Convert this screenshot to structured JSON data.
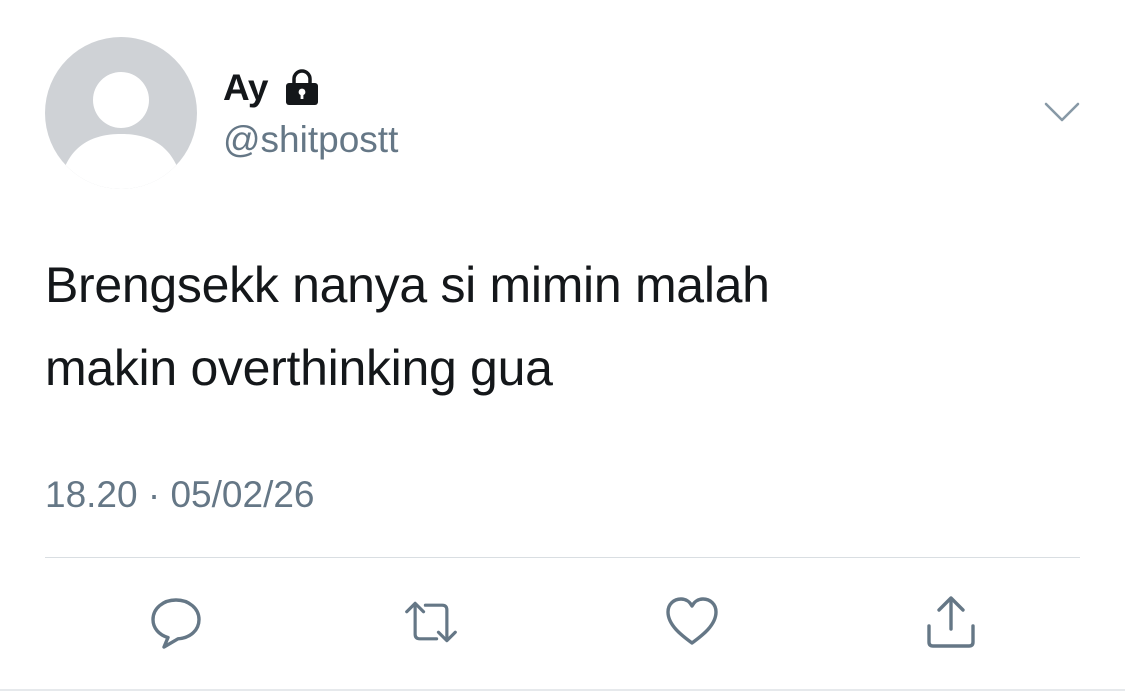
{
  "author": {
    "display_name": "Ay",
    "handle": "@shitpostt",
    "avatar_icon": "default-avatar-icon",
    "protected_icon": "lock-icon"
  },
  "tweet": {
    "text_lines": [
      "Brengsekk nanya si mimin malah",
      "makin overthinking gua"
    ],
    "time": "18.20",
    "separator": "·",
    "date": "05/02/26"
  },
  "actions": [
    {
      "name": "reply",
      "icon": "comment-icon"
    },
    {
      "name": "retweet",
      "icon": "retweet-icon"
    },
    {
      "name": "like",
      "icon": "heart-icon"
    },
    {
      "name": "share",
      "icon": "share-icon"
    }
  ],
  "colors": {
    "text_primary": "#14171a",
    "text_secondary": "#657786",
    "icon": "#657786",
    "avatar_bg": "#cfd2d6",
    "divider": "#d9dee2"
  }
}
